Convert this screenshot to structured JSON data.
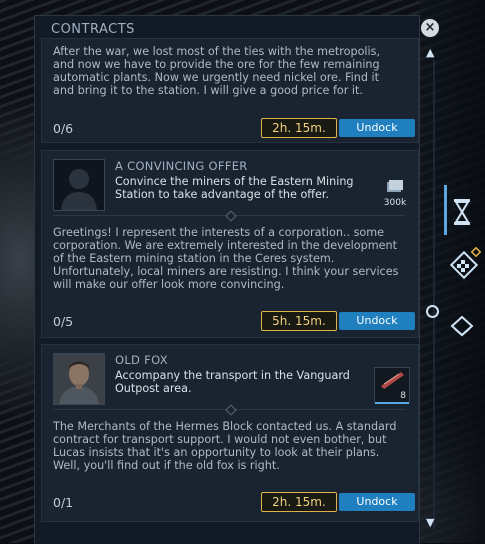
{
  "panel": {
    "title": "CONTRACTS"
  },
  "contracts": [
    {
      "description": "After the war, we lost most of the ties with the metropolis, and now we have to provide the ore for the few remaining automatic plants. Now we urgently need nickel ore. Find it and bring it to the station. I will give a good price for it.",
      "progress": "0/6",
      "timer": "2h. 15m.",
      "action": "Undock"
    },
    {
      "title": "A CONVINCING OFFER",
      "subtitle": "Convince the miners of the Eastern Mining Station to take advantage of the offer.",
      "reward_label": "300k",
      "reward_icon": "credits-icon",
      "description": "Greetings! I represent the interests of a corporation.. some corporation. We are extremely interested in the development of the Eastern mining station in the Ceres system. Unfortunately, local miners are resisting. I think your services will make our offer look more convincing.",
      "progress": "0/5",
      "timer": "5h. 15m.",
      "action": "Undock"
    },
    {
      "title": "OLD FOX",
      "subtitle": "Accompany the transport in the Vanguard Outpost area.",
      "reward_label": "8",
      "reward_icon": "cargo-item-icon",
      "description": "The Merchants of the Hermes Block contacted us. A standard contract for transport support. I would not even bother, but Lucas insists that it's an opportunity to look at their plans. Well, you'll find out if the old fox is right.",
      "progress": "0/1",
      "timer": "2h. 15m.",
      "action": "Undock"
    }
  ],
  "colors": {
    "accent": "#1f7fbf",
    "timer_border": "#e0b24a",
    "panel_bg": "#121a25"
  },
  "side_icons": [
    "hourglass-icon",
    "dice-icon",
    "layers-icon"
  ]
}
